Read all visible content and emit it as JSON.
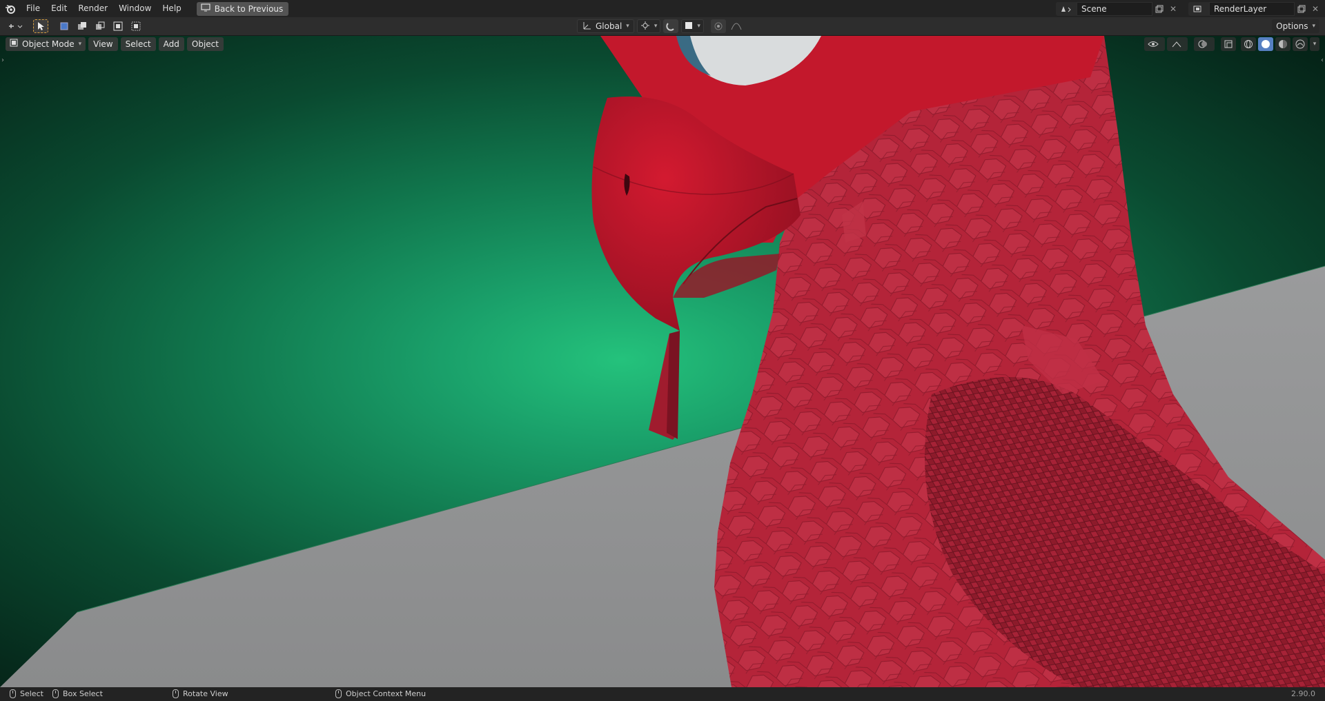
{
  "topbar": {
    "menu": [
      "File",
      "Edit",
      "Render",
      "Window",
      "Help"
    ],
    "back_button": "Back to Previous",
    "scene": "Scene",
    "render_layer": "RenderLayer"
  },
  "header": {
    "transform_orientation": "Global",
    "options": "Options"
  },
  "viewport": {
    "mode": "Object Mode",
    "menus": [
      "View",
      "Select",
      "Add",
      "Object"
    ]
  },
  "statusbar": {
    "select": "Select",
    "box_select": "Box Select",
    "rotate_view": "Rotate View",
    "context_menu": "Object Context Menu",
    "version": "2.90.0"
  },
  "colors": {
    "accent": "#5680c2",
    "background_green": "#24c27c",
    "bird_red": "#b0203a",
    "floor_gray": "#8e8e8e"
  }
}
